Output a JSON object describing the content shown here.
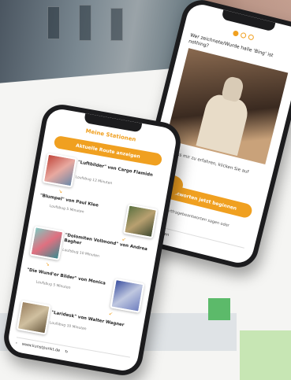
{
  "back_phone": {
    "question": "Wer zeichnete/Wurde halle 'Bing' ist nothing?",
    "hint": "Ich muss mir zu erfahren, klicken Sie auf weiter.",
    "button": "Antworten jetzt beginnen",
    "small": "Zur Antwortfragebeantworten sagen oder",
    "url": "Inhalt ▪ Wien"
  },
  "front_phone": {
    "title": "Meine Stationen",
    "button": "Aktuelle Route anzeigen",
    "stations": [
      {
        "name": "\"Luftbilder\" von Cargo Flamidn",
        "sub": "Loufsbug 12 Minuten"
      },
      {
        "name": "\"Blumpel\" von Paul Klee",
        "sub": "Loufsbug 5 Minuten"
      },
      {
        "name": "\"Dolomiten Vollmond\" von Andrea Bagher",
        "sub": "Loufsbug 10 Minuten"
      },
      {
        "name": "\"Die Wund'er Bilder\" von Monica",
        "sub": "Loufsbug 5 Minuten"
      },
      {
        "name": "\"Laridesk\" von Walter Wagner",
        "sub": "Loufsbug 10 Minuten"
      }
    ],
    "url": "www.kunstpunkt.de"
  },
  "colors": {
    "accent": "#f0a020",
    "green": "#5cba6a",
    "light_green": "#c7e6b4"
  }
}
